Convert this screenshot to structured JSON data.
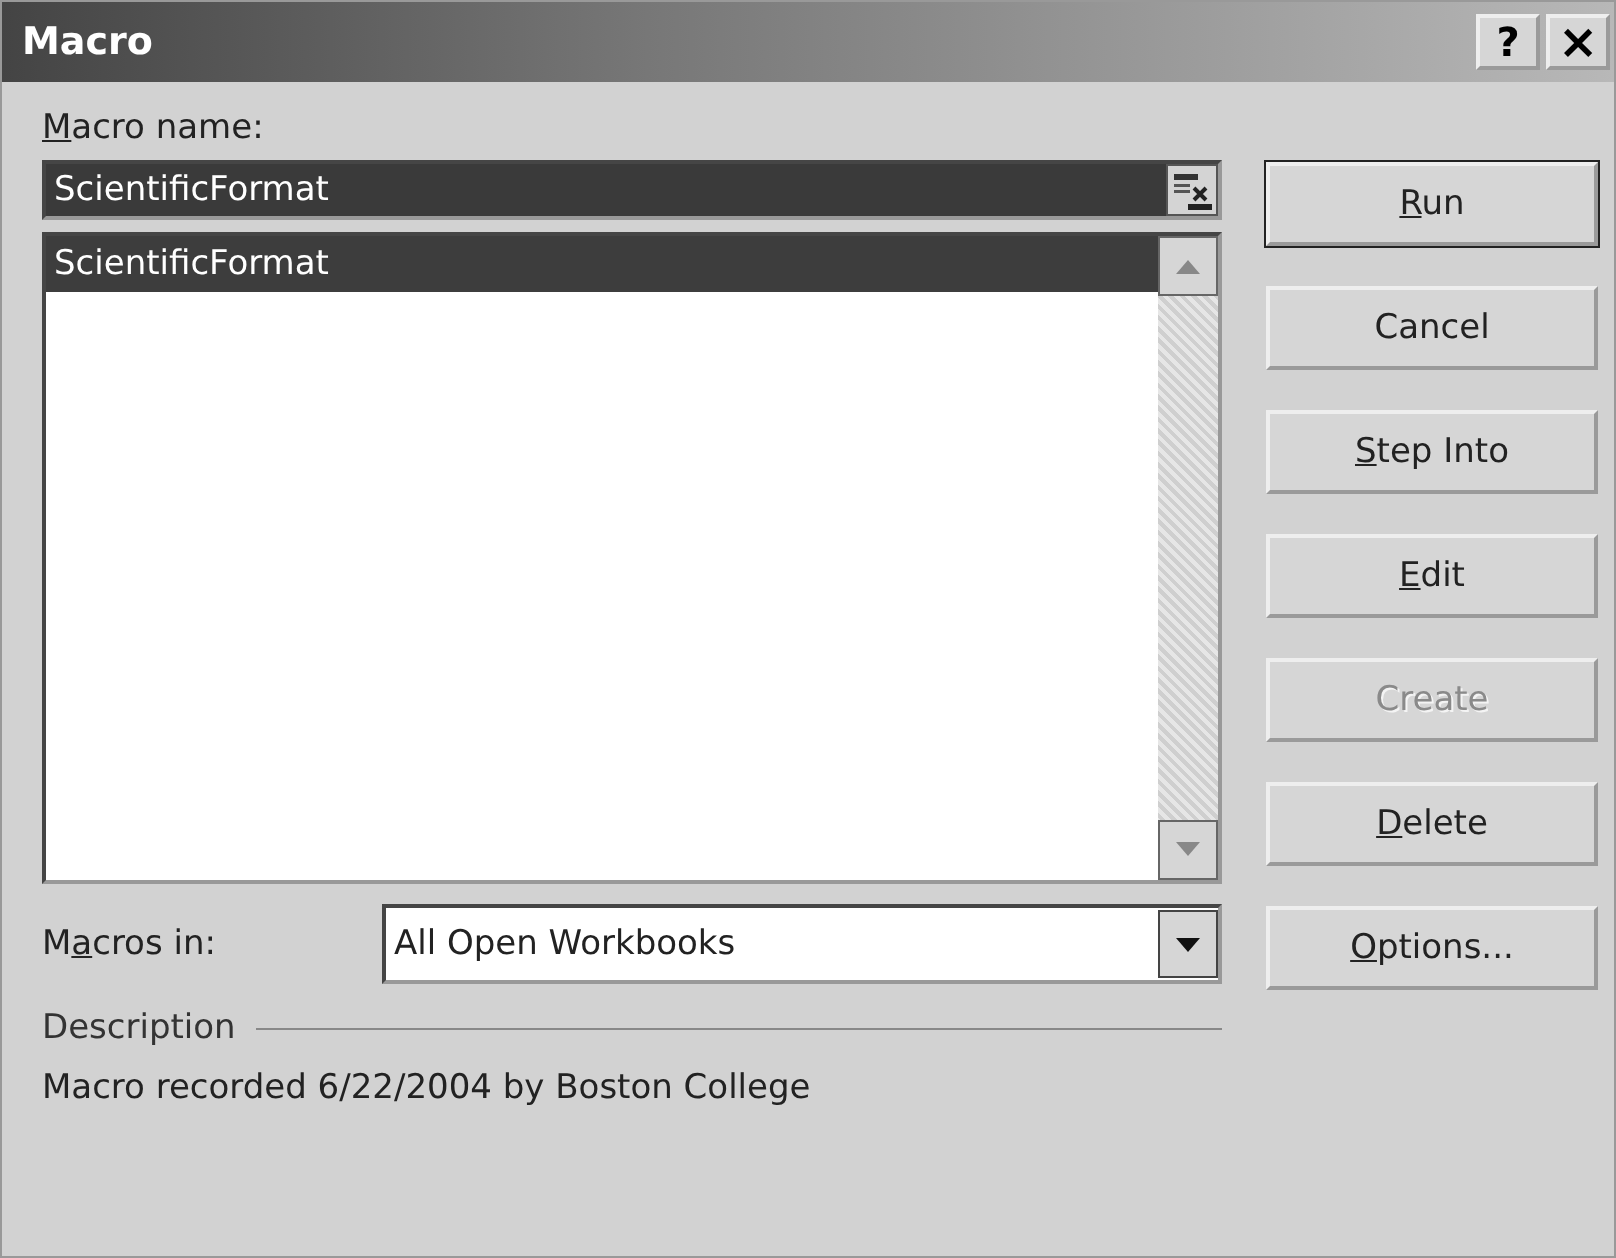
{
  "window": {
    "title": "Macro",
    "controls": [
      {
        "kind": "help",
        "label": "?"
      },
      {
        "kind": "close",
        "label": "×"
      }
    ]
  },
  "macro_name": {
    "label": {
      "key": "M",
      "after": "acro name:"
    },
    "value": "ScientificFormat"
  },
  "macro_list": {
    "items": [
      {
        "label": "ScientificFormat",
        "selected": true
      }
    ]
  },
  "macros_in": {
    "label": {
      "before": "M",
      "key": "a",
      "after": "cros in:"
    },
    "value": "All Open Workbooks"
  },
  "description": {
    "heading": "Description",
    "text": "Macro recorded 6/22/2004 by Boston College"
  },
  "buttons": [
    {
      "label": {
        "key": "R",
        "after": "un"
      },
      "disabled": false,
      "default": true
    },
    {
      "label": {
        "before": "Cancel"
      },
      "disabled": false,
      "default": false
    },
    {
      "label": {
        "key": "S",
        "after": "tep Into"
      },
      "disabled": false,
      "default": false
    },
    {
      "label": {
        "key": "E",
        "after": "dit"
      },
      "disabled": false,
      "default": false
    },
    {
      "label": {
        "before": "Create"
      },
      "disabled": true,
      "default": false
    },
    {
      "label": {
        "key": "D",
        "after": "elete"
      },
      "disabled": false,
      "default": false
    },
    {
      "label": {
        "key": "O",
        "after": "ptions..."
      },
      "disabled": false,
      "default": false
    }
  ]
}
